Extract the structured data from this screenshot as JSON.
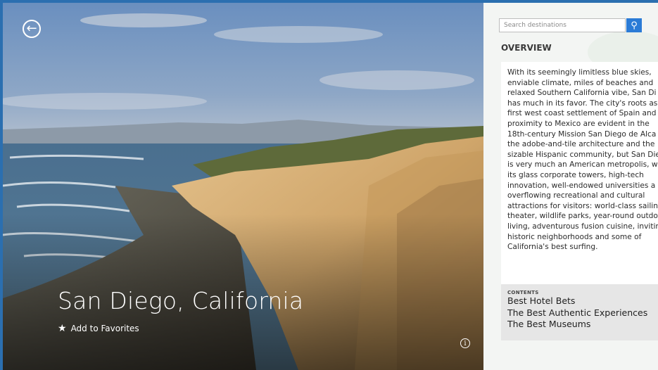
{
  "hero": {
    "title": "San Diego, California",
    "favorites_label": "Add to Favorites",
    "back_icon": "back-arrow-icon",
    "info_icon": "info-icon",
    "star_icon": "star-icon"
  },
  "search": {
    "placeholder": "Search destinations",
    "button_icon": "search-icon"
  },
  "overview": {
    "heading": "OVERVIEW",
    "text": "With its seemingly limitless blue skies,\nenviable climate, miles of beaches and\nrelaxed Southern California vibe, San Di\nhas much in its favor. The city's roots as\nfirst west coast settlement of Spain and\nproximity to Mexico are evident in the\n18th-century Mission San Diego de Alca\nthe adobe-and-tile architecture and the\nsizable Hispanic community, but San Die\nis very much an American metropolis, w\nits glass corporate towers, high-tech\ninnovation, well-endowed universities a\noverflowing recreational and cultural\nattractions for visitors: world-class sailin\ntheater, wildlife parks, year-round outdo\nliving, adventurous fusion cuisine, invitin\nhistoric neighborhoods and some of\nCalifornia's best surfing."
  },
  "contents": {
    "label": "CONTENTS",
    "items": [
      "Best Hotel Bets",
      "The Best Authentic Experiences",
      "The Best Museums"
    ]
  },
  "colors": {
    "accent": "#2b7bd6",
    "frame": "#2b6fb0"
  }
}
